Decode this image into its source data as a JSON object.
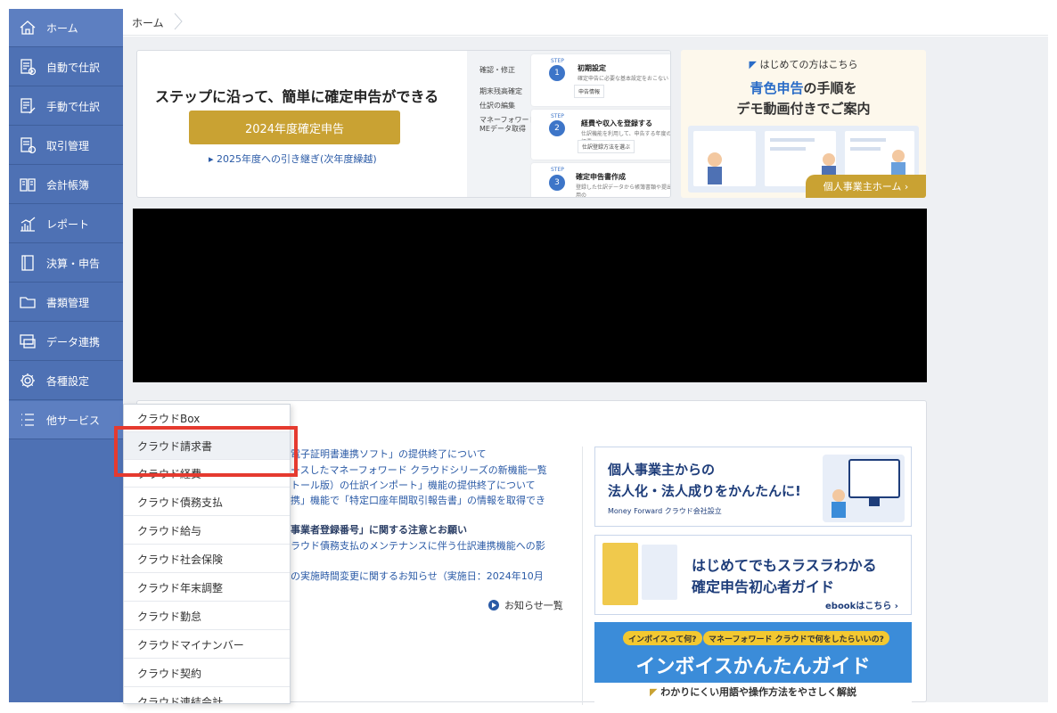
{
  "sidebar": {
    "items": [
      {
        "label": "ホーム",
        "icon": "home-icon"
      },
      {
        "label": "自動で仕訳",
        "icon": "auto-journal-icon"
      },
      {
        "label": "手動で仕訳",
        "icon": "manual-journal-icon"
      },
      {
        "label": "取引管理",
        "icon": "transaction-icon"
      },
      {
        "label": "会計帳簿",
        "icon": "book-icon"
      },
      {
        "label": "レポート",
        "icon": "report-icon"
      },
      {
        "label": "決算・申告",
        "icon": "settlement-icon"
      },
      {
        "label": "書類管理",
        "icon": "folder-icon"
      },
      {
        "label": "データ連携",
        "icon": "data-link-icon"
      },
      {
        "label": "各種設定",
        "icon": "gear-icon"
      },
      {
        "label": "他サービス",
        "icon": "list-icon"
      }
    ]
  },
  "breadcrumb": {
    "home": "ホーム"
  },
  "banner1": {
    "title": "ステップに沿って、簡単に確定申告ができる",
    "button": "2024年度確定申告",
    "link": "2025年度への引き継ぎ(次年度繰越)",
    "side_items": [
      "確認・修正",
      "期末残高確定",
      "仕訳の編集",
      "マネーフォワード",
      "MEデータ取得"
    ],
    "step1": {
      "step": "STEP",
      "num": "1",
      "title": "初期設定",
      "sub": "確定申告に必要な基本設定をおこない",
      "field": "申告情報"
    },
    "step2": {
      "step": "STEP",
      "num": "2",
      "title": "経費や収入を登録する",
      "sub": "仕訳機能を利用して、申告する年度の経費",
      "field": "仕訳登録方法を選ぶ"
    },
    "step3": {
      "step": "STEP",
      "num": "3",
      "title": "確定申告書作成",
      "sub": "登録した仕訳データから帳簿書類や提出用の"
    }
  },
  "banner2": {
    "top": "はじめての方はこちら",
    "line1_highlight": "青色申告",
    "line1_rest": "の手順を",
    "line2": "デモ動画付きでご案内",
    "cta": "個人事業主ホーム ›"
  },
  "news": {
    "items": [
      {
        "text": "電子証明書連携ソフト」の提供終了について",
        "bold": false
      },
      {
        "text": "ースしたマネーフォワード クラウドシリーズの新機能一覧",
        "bold": false
      },
      {
        "text": "トール版）の仕訳インポート」機能の提供終了について",
        "bold": false
      },
      {
        "text": "携」機能で「特定口座年間取引報告書」の情報を取得でき",
        "bold": false
      },
      {
        "text": "事業者登録番号」に関する注意とお願い",
        "bold": true
      },
      {
        "text": "ラウド債務支払のメンテナンスに伴う仕訳連携機能への影",
        "bold": false
      },
      {
        "text": "の実施時間変更に関するお知らせ（実施日：2024年10月",
        "bold": false
      }
    ],
    "all_link": "お知らせ一覧"
  },
  "ads": {
    "ad1": {
      "line1": "個人事業主からの",
      "line2": "法人化・法人成りをかんたんに!",
      "logo": "Money Forward クラウド会社設立"
    },
    "ad2": {
      "line1": "はじめてでもスラスラわかる",
      "line2": "確定申告初心者ガイド",
      "link": "ebookはこちら ›"
    },
    "ad3": {
      "pill1": "インボイスって何?",
      "pill2": "マネーフォワード クラウドで何をしたらいいの?",
      "title": "インボイスかんたんガイド",
      "sub": "わかりにくい用語や操作方法をやさしく解説"
    }
  },
  "dropdown": {
    "items": [
      "クラウドBox",
      "クラウド請求書",
      "クラウド経費",
      "クラウド債務支払",
      "クラウド給与",
      "クラウド社会保険",
      "クラウド年末調整",
      "クラウド勤怠",
      "クラウドマイナンバー",
      "クラウド契約",
      "クラウド連結会計"
    ]
  },
  "colors": {
    "sidebar": "#4e71b4",
    "gold": "#c9a233",
    "link": "#2a5aa6",
    "highlight": "#e53a2f"
  }
}
